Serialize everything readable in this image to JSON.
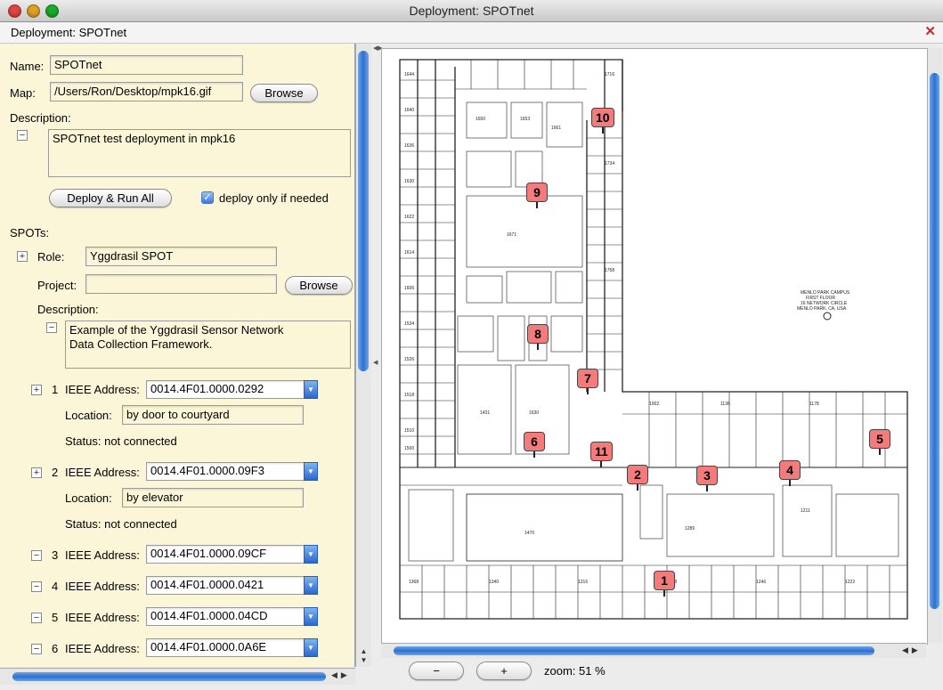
{
  "window": {
    "title": "Deployment: SPOTnet"
  },
  "panel": {
    "title": "Deployment: SPOTnet",
    "close_glyph": "✕"
  },
  "deployment": {
    "name_label": "Name:",
    "name_value": "SPOTnet",
    "map_label": "Map:",
    "map_value": "/Users/Ron/Desktop/mpk16.gif",
    "browse_label": "Browse",
    "description_label": "Description:",
    "description_value": "SPOTnet test deployment in mpk16",
    "deploy_button": "Deploy & Run All",
    "deploy_only_label": "deploy only if needed",
    "deploy_only_checked": true
  },
  "spots": {
    "heading": "SPOTs:",
    "role_label": "Role:",
    "role_value": "Yggdrasil SPOT",
    "project_label": "Project:",
    "project_value": "",
    "browse_label": "Browse",
    "description_label": "Description:",
    "description_value": "Example of the Yggdrasil Sensor Network\nData Collection Framework.",
    "ieee_label": "IEEE Address:",
    "location_label": "Location:",
    "status_label": "Status:",
    "items": [
      {
        "num": "1",
        "toggle": "+",
        "address": "0014.4F01.0000.0292",
        "location": "by door to courtyard",
        "status": "not connected"
      },
      {
        "num": "2",
        "toggle": "+",
        "address": "0014.4F01.0000.09F3",
        "location": "by elevator",
        "status": "not connected"
      },
      {
        "num": "3",
        "toggle": "−",
        "address": "0014.4F01.0000.09CF"
      },
      {
        "num": "4",
        "toggle": "−",
        "address": "0014.4F01.0000.0421"
      },
      {
        "num": "5",
        "toggle": "−",
        "address": "0014.4F01.0000.04CD"
      },
      {
        "num": "6",
        "toggle": "−",
        "address": "0014.4F01.0000.0A6E"
      }
    ]
  },
  "map": {
    "zoom_out": "−",
    "zoom_in": "+",
    "zoom_text": "zoom: 51 %",
    "markers": [
      "1",
      "2",
      "3",
      "4",
      "5",
      "6",
      "7",
      "8",
      "9",
      "10",
      "11"
    ],
    "building_note": "MENLO PARK CAMPUS\nFIRST FLOOR\n16 NETWORK CIRCLE\nMENLO PARK, CA, USA"
  }
}
